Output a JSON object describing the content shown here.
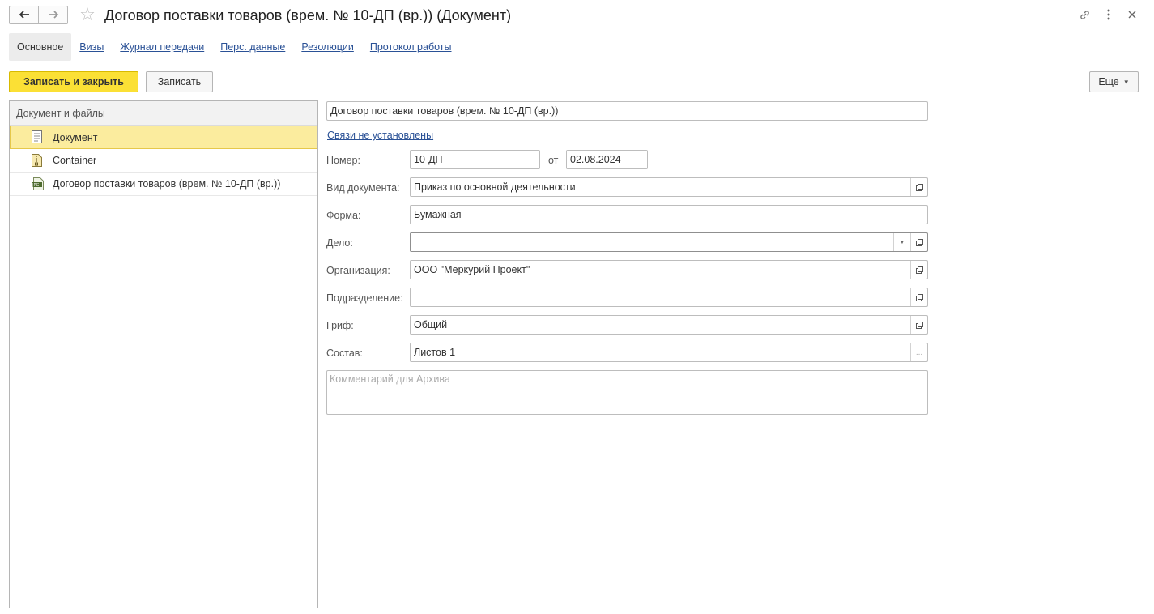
{
  "window": {
    "title": "Договор поставки товаров (врем. № 10-ДП (вр.)) (Документ)"
  },
  "icons": {
    "back": "arrow-left-icon",
    "forward": "arrow-right-icon",
    "favorite": "star-icon",
    "link": "link-icon",
    "more": "kebab-menu-icon",
    "close": "close-icon"
  },
  "tabs": [
    {
      "label": "Основное",
      "active": true
    },
    {
      "label": "Визы"
    },
    {
      "label": "Журнал передачи"
    },
    {
      "label": "Перс. данные"
    },
    {
      "label": "Резолюции"
    },
    {
      "label": "Протокол работы"
    }
  ],
  "toolbar": {
    "save_close_label": "Записать и закрыть",
    "save_label": "Записать",
    "more_label": "Еще"
  },
  "files_panel": {
    "header": "Документ и файлы",
    "items": [
      {
        "label": "Документ",
        "icon": "document-icon",
        "selected": true
      },
      {
        "label": "Container",
        "icon": "archive-file-icon"
      },
      {
        "label": "Договор поставки товаров (врем. № 10-ДП (вр.))",
        "icon": "jpg-file-icon"
      }
    ]
  },
  "form": {
    "name_value": "Договор поставки товаров (врем. № 10-ДП (вр.))",
    "links_text": "Связи не установлены",
    "number_label": "Номер:",
    "number_value": "10-ДП",
    "date_sep": "от",
    "date_value": "02.08.2024",
    "doc_type_label": "Вид документа:",
    "doc_type_value": "Приказ по основной деятельности",
    "form_label": "Форма:",
    "form_value": "Бумажная",
    "case_label": "Дело:",
    "case_value": "",
    "org_label": "Организация:",
    "org_value": "ООО \"Меркурий Проект\"",
    "dept_label": "Подразделение:",
    "dept_value": "",
    "stamp_label": "Гриф:",
    "stamp_value": "Общий",
    "composition_label": "Состав:",
    "composition_value": "Листов 1",
    "comment_placeholder": "Комментарий для Архива"
  }
}
